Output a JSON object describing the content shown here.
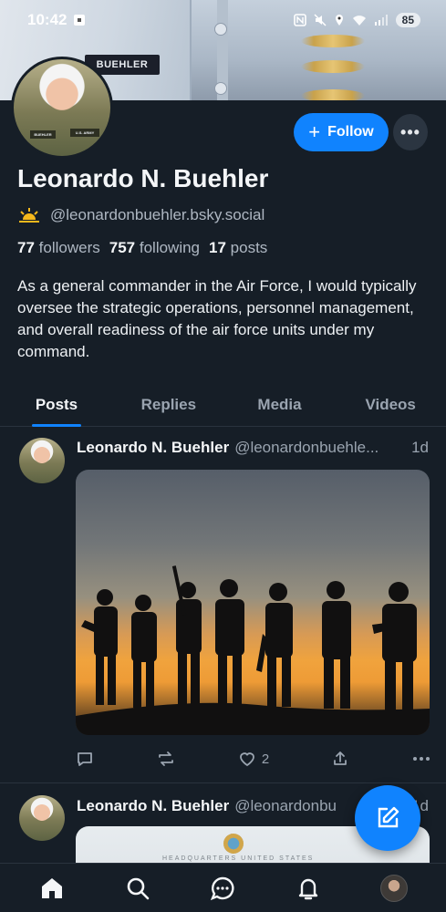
{
  "status_bar": {
    "time": "10:42",
    "battery": "85"
  },
  "banner": {
    "nametag": "BUEHLER"
  },
  "avatar_badges": {
    "left": "BUEHLER",
    "right": "U.S. ARMY"
  },
  "profile": {
    "follow_label": "Follow",
    "follow_icon": "plus-icon",
    "more_label": "•••",
    "display_name": "Leonardo N. Buehler",
    "handle": "@leonardonbuehler.bsky.social",
    "followers_count": "77",
    "followers_label": "followers",
    "following_count": "757",
    "following_label": "following",
    "posts_count": "17",
    "posts_label": "posts",
    "bio": "As a general commander in the Air Force, I would typically oversee the strategic operations, personnel management, and overall readiness of the air force units under my command."
  },
  "tabs": [
    {
      "label": "Posts",
      "active": true
    },
    {
      "label": "Replies",
      "active": false
    },
    {
      "label": "Media",
      "active": false
    },
    {
      "label": "Videos",
      "active": false
    }
  ],
  "posts": [
    {
      "author": "Leonardo N. Buehler",
      "handle": "@leonardonbuehle...",
      "time": "1d",
      "likes": "2"
    },
    {
      "author": "Leonardo N. Buehler",
      "handle": "@leonardonbu",
      "time": "1d",
      "image_caption": "HEADQUARTERS UNITED STATES"
    }
  ],
  "colors": {
    "background": "#161e27",
    "accent": "#1083fe",
    "muted_text": "#9aa4b0"
  },
  "nav_icons": [
    "home-icon",
    "search-icon",
    "chat-icon",
    "notifications-icon",
    "profile-avatar"
  ]
}
